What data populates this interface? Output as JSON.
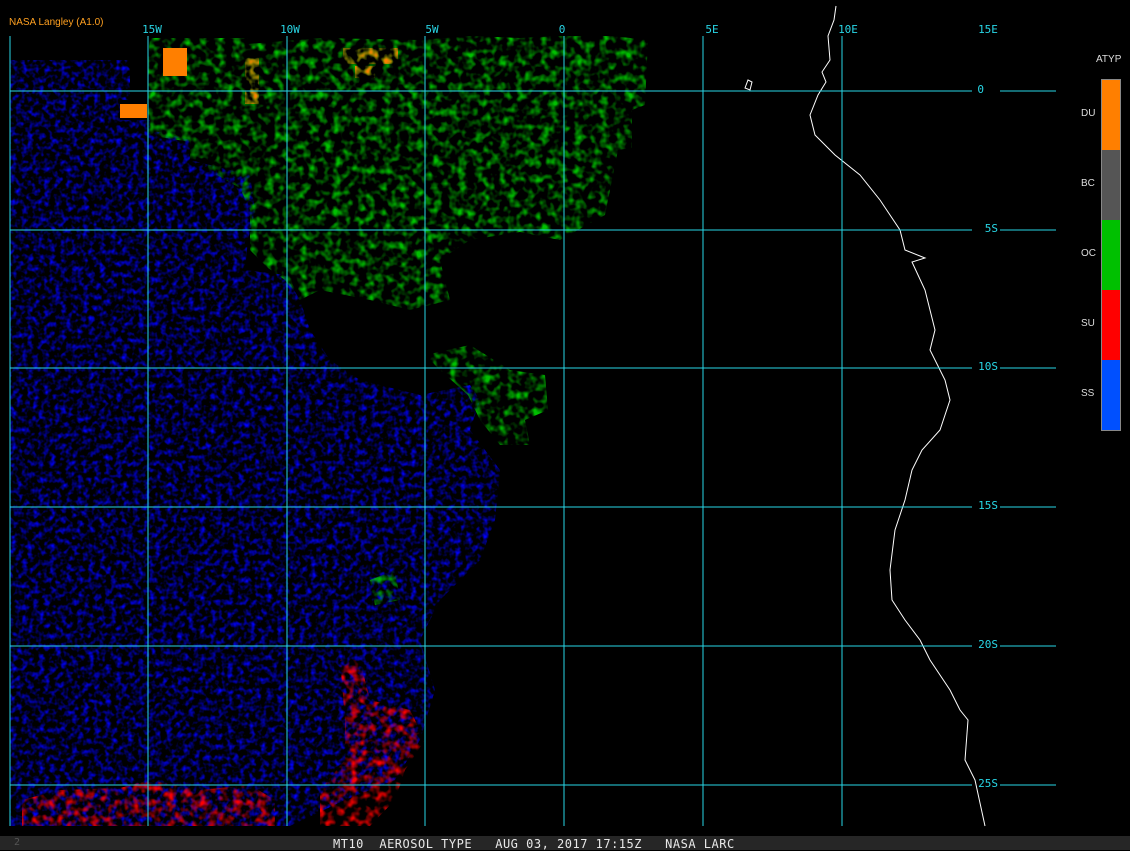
{
  "credit": "NASA Langley (A1.0)",
  "grid": {
    "lon_labels": [
      "15W",
      "10W",
      "5W",
      "0",
      "5E",
      "10E",
      "15E"
    ],
    "lat_labels": [
      "0",
      "5S",
      "10S",
      "15S",
      "20S",
      "25S"
    ]
  },
  "legend": {
    "title": "ATYP",
    "items": [
      {
        "label": "DU",
        "color": "#ff7f00"
      },
      {
        "label": "BC",
        "color": "#555555"
      },
      {
        "label": "OC",
        "color": "#00c000"
      },
      {
        "label": "SU",
        "color": "#ff0000"
      },
      {
        "label": "SS",
        "color": "#0050ff"
      }
    ]
  },
  "colors": {
    "grid": "#28d6e6",
    "coastline": "#ffffff",
    "ss": "#0000ff",
    "oc": "#00c000",
    "su": "#ff0000",
    "du": "#ff7f00"
  },
  "footer": {
    "text": "MT10  AEROSOL TYPE   AUG 03, 2017 17:15Z   NASA LARC",
    "page_number": "2"
  }
}
